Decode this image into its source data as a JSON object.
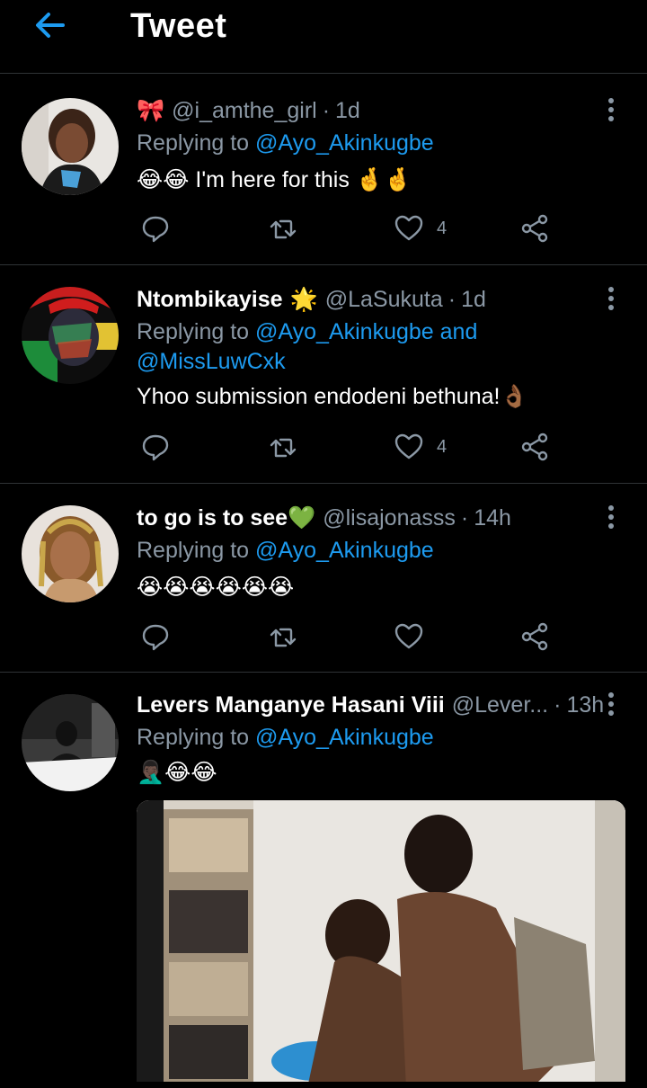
{
  "header": {
    "title": "Tweet",
    "back_icon": "arrow-left-icon"
  },
  "colors": {
    "accent": "#1d9bf0",
    "muted": "#8b98a5",
    "divider": "#2f3336"
  },
  "tweets": [
    {
      "badge": "🎀",
      "name": "",
      "handle": "@i_amthe_girl",
      "time": "1d",
      "reply_prefix": "Replying to ",
      "mentions": "@Ayo_Akinkugbe",
      "mentions2": "",
      "text": "😂😂 I'm here for this 🤞🤞",
      "likes": "4"
    },
    {
      "badge": "🌟",
      "name": "Ntombikayise",
      "handle": "@LaSukuta",
      "time": "1d",
      "reply_prefix": "Replying to ",
      "mentions": "@Ayo_Akinkugbe and",
      "mentions2": "@MissLuwCxk",
      "text": "Yhoo submission endodeni bethuna!👌🏾",
      "likes": "4"
    },
    {
      "badge": "💚",
      "name": "to go is to see",
      "handle": "@lisajonasss",
      "time": "14h",
      "reply_prefix": "Replying to ",
      "mentions": "@Ayo_Akinkugbe",
      "mentions2": "",
      "text": "😭😭😭😭😭😭",
      "likes": ""
    },
    {
      "badge": "",
      "name": "Levers Manganye Hasani Viii",
      "handle": "@Lever...",
      "time": "13h",
      "reply_prefix": "Replying to ",
      "mentions": "@Ayo_Akinkugbe",
      "mentions2": "",
      "text": "🤦🏿‍♂️😂😂",
      "likes": ""
    }
  ],
  "dot": "·"
}
